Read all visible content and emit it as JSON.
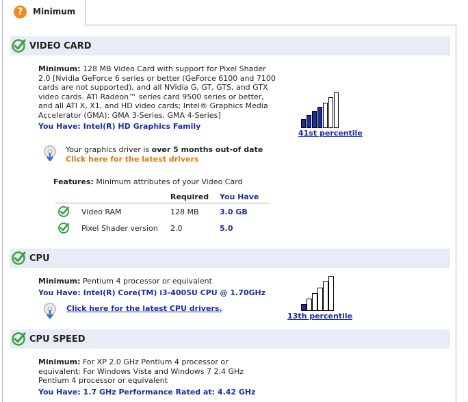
{
  "tab": {
    "icon": "question-icon",
    "icon_glyph": "?",
    "label": "Minimum"
  },
  "accent": "#1a2fa0",
  "video": {
    "title": "VIDEO CARD",
    "min_label": "Minimum:",
    "min_lines": [
      " 128 MB Video Card with support for Pixel Shader",
      "2.0 [Nvidia GeForce 6 series or better (GeForce 6100 and 7100",
      "cards are not supported), and all NVidia G, GT, GTS, and GTX",
      "video cards. ATI Radeon™ series card 9500 series or better,",
      "and all ATI X, X1, and HD video cards; Intel® Graphics Media",
      "Accelerator (GMA): GMA 3-Series, GMA 4-Series]"
    ],
    "have": "You Have: Intel(R) HD Graphics Family",
    "percentile": "41st percentile",
    "percentile_value": 41,
    "driver_pre": "Your graphics driver is ",
    "driver_bold": "over 5 months out-of date",
    "driver_link": "Click here for the latest drivers",
    "features_label": "Features:",
    "features_desc": " Minimum attributes of your Video Card",
    "col_required": "Required",
    "col_have": "You Have",
    "rows": [
      {
        "name": "Video RAM",
        "required": "128 MB",
        "have": "3.0 GB"
      },
      {
        "name": "Pixel Shader version",
        "required": "2.0",
        "have": "5.0"
      }
    ]
  },
  "cpu": {
    "title": "CPU",
    "min_label": "Minimum:",
    "min_text": " Pentium 4 processor or equivalent",
    "have": "You Have: Intel(R) Core(TM) i3-4005U CPU @ 1.70GHz",
    "driver_link": "Click here for the latest CPU drivers.",
    "percentile": "13th percentile",
    "percentile_value": 13
  },
  "speed": {
    "title": "CPU SPEED",
    "min_label": "Minimum:",
    "min_lines": [
      " For XP 2.0 GHz Pentium 4 processor or",
      "equivalent; For Windows Vista and Windows 7 2.4 GHz",
      "Pentium 4 processor or equivalent"
    ],
    "have": "You Have: 1.7 GHz Performance Rated at: 4.42 GHz"
  }
}
